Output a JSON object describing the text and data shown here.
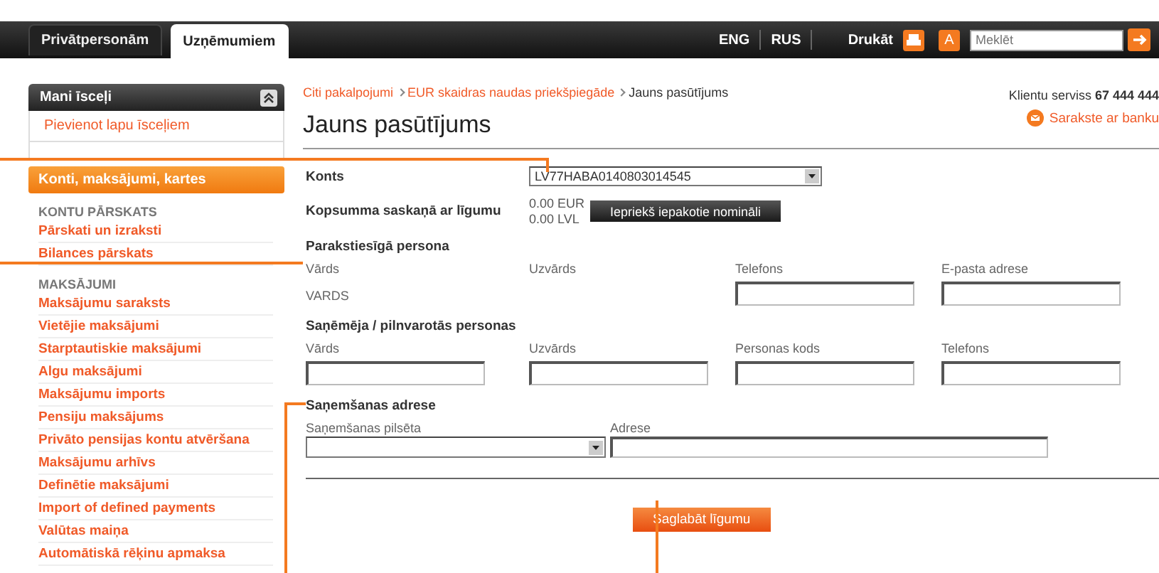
{
  "top_tabs": [
    {
      "label": "Privātpersonām",
      "selected": false
    },
    {
      "label": "Uzņēmumiem",
      "selected": true
    }
  ],
  "header": {
    "languages": [
      "ENG",
      "RUS"
    ],
    "print": "Drukāt",
    "font_button": "A",
    "search": {
      "placeholder": "Meklēt"
    }
  },
  "sidebar": {
    "favorites": {
      "title": "Mani īsceļi",
      "expanded": true,
      "items": [
        "Pievienot lapu īsceļiem"
      ]
    },
    "active_menu": "Konti, maksājumi, kartes",
    "sections": [
      {
        "title": "KONTU PĀRSKATS",
        "items": [
          "Pārskati un izraksti",
          "Bilances pārskats"
        ]
      },
      {
        "title": "MAKSĀJUMI",
        "items": [
          "Maksājumu saraksts",
          "Vietējie maksājumi",
          "Starptautiskie maksājumi",
          "Algu maksājumi",
          "Maksājumu imports",
          "Pensiju maksājums",
          "Privāto pensijas kontu atvēršana",
          "Maksājumu arhīvs",
          "Definētie maksājumi",
          "Import of defined payments",
          "Valūtas maiņa",
          "Automātiskā rēķinu apmaksa"
        ]
      }
    ]
  },
  "breadcrumb": [
    {
      "label": "Citi pakalpojumi",
      "link": true
    },
    {
      "label": "EUR skaidras naudas priekšpiegāde",
      "link": true
    },
    {
      "label": "Jauns pasūtījums",
      "link": false
    }
  ],
  "title": "Jauns pasūtījums",
  "customer_service": "Klientu serviss **67 444 444**",
  "contact_link": "Sarakste ar banku",
  "account": {
    "label": "Konts",
    "value": "LV77HABA0140803014545"
  },
  "total": {
    "label": "Kopsumma saskaņā ar līgumu",
    "amounts": [
      "0.00 EUR",
      "0.00 LVL"
    ],
    "button": "Iepriekš iepakotie nomināli"
  },
  "sections": [
    {
      "title": "Parakstiesīgā persona",
      "fields": [
        {
          "label": "Vārds",
          "kind": "text",
          "value": "VARDS"
        },
        {
          "label": "Uzvārds",
          "kind": "empty"
        },
        {
          "label": "Telefons",
          "kind": "input"
        },
        {
          "label": "E-pasta adrese",
          "kind": "input"
        }
      ]
    },
    {
      "title": "Saņēmēja / pilnvarotās personas",
      "fields": [
        {
          "label": "Vārds",
          "kind": "input"
        },
        {
          "label": "Uzvārds",
          "kind": "input"
        },
        {
          "label": "Personas kods",
          "kind": "input"
        },
        {
          "label": "Telefons",
          "kind": "input"
        }
      ]
    }
  ],
  "delivery": {
    "title": "Saņemšanas adrese",
    "city_label": "Saņemšanas pilsēta",
    "address_label": "Adrese"
  },
  "save_button": "Saglabāt līgumu"
}
